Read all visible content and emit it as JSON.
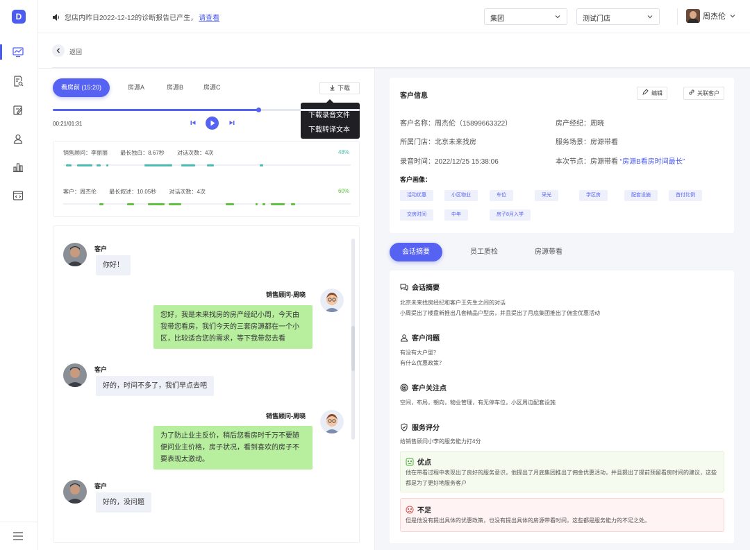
{
  "app": {
    "logo": "D"
  },
  "nav": [
    {
      "icon": "dashboard-chart-icon"
    },
    {
      "icon": "document-search-icon"
    },
    {
      "icon": "edit-document-icon"
    },
    {
      "icon": "user-icon"
    },
    {
      "icon": "bar-chart-icon"
    },
    {
      "icon": "code-window-icon"
    },
    {
      "icon": "menu-icon"
    }
  ],
  "header": {
    "notice": "您店内昨日2022-12-12的诊断报告已产生，",
    "notice_link": "请查看",
    "select_group": "集团",
    "select_store": "测试门店",
    "user_name": "周杰伦"
  },
  "back_label": "返回",
  "audio_tabs": [
    "看房前 (15:20)",
    "房源A",
    "房源B",
    "房源C"
  ],
  "download": {
    "label": "下载",
    "menu": [
      "下载录音文件",
      "下载转译文本"
    ]
  },
  "player": {
    "time": "00:21/01:31",
    "progress": 0.67
  },
  "stats": {
    "sales": {
      "role": "销售顾问：李丽丽",
      "longest": "最长独白：8.67秒",
      "turns": "对话次数：4次",
      "pct": "48%"
    },
    "customer": {
      "role": "客户：周杰伦",
      "longest": "最长叙述：10.05秒",
      "turns": "对话次数：4次",
      "pct": "60%"
    }
  },
  "chat": [
    {
      "who": "客户",
      "text": "你好！"
    },
    {
      "who": "销售顾问-周晓",
      "text": "您好，我是未来找房的房产经纪小周，今天由我带您看房，我们今天的三套房源都在一个小区，比较适合您的需求，等下我带您去看"
    },
    {
      "who": "客户",
      "text": "好的，时间不多了，我们早点去吧"
    },
    {
      "who": "销售顾问-周晓",
      "text": "为了防止业主反价，稍后您看房时千万不要随便问业主价格，房子状况，看到喜欢的房子不要表现太激动。"
    },
    {
      "who": "客户",
      "text": "好的，没问题"
    }
  ],
  "customer_info": {
    "title": "客户信息",
    "edit": "编辑",
    "link": "关联客户",
    "name": "客户名称：周杰伦（15899663322）",
    "agent": "房产经纪：周晓",
    "store": "所属门店：北京未来找房",
    "scene": "服务场景：房源带看",
    "record_time": "录音时间：2022/12/25  15:38:06",
    "node_prefix": "本次节点：房源带看",
    "node_highlight": "“房源B看房时间最长”",
    "portrait_label": "客户画像：",
    "tags": [
      "活动优惠",
      "小区物业",
      "车位",
      "采光",
      "学区房",
      "配套设施",
      "首付比例",
      "交房时间",
      "中年",
      "房子8月入学"
    ]
  },
  "summary_tabs": [
    "会话摘要",
    "员工质检",
    "房源带看"
  ],
  "summary": {
    "s1_title": "会话摘要",
    "s1_lines": [
      "北京未来找房经纪和客户王先生之间的对话",
      "小周提出了楼盘新推出几套精品户型房，并且提出了月底集团推出了佣金优惠活动"
    ],
    "s2_title": "客户问题",
    "s2_lines": [
      "有没有大户型？",
      "有什么优惠政策？"
    ],
    "s3_title": "客户关注点",
    "s3_lines": [
      "空间，布局，朝向，物业管理，有无停车位，小区周边配套设施"
    ],
    "s4_title": "服务评分",
    "s4_lines": [
      "给销售顾问小李的服务能力打4分"
    ],
    "good_title": "优点",
    "good_text": "他在带看过程中表现出了良好的服务意识，他提出了月底集团推出了佣金优惠活动，并且提出了提前预留看房时间的建议，这些都是为了更好地服务客户",
    "bad_title": "不足",
    "bad_text": "但是他没有提出具体的优惠政策，也没有提出具体的房源带看时间，这些都是服务能力的不足之处。"
  },
  "colors": {
    "accent": "#5663f2",
    "sales_bubble": "#b7ef9f",
    "customer_bubble": "#eef1f8",
    "pct_sales": "#4bbdb0",
    "pct_customer": "#5fc33f"
  }
}
